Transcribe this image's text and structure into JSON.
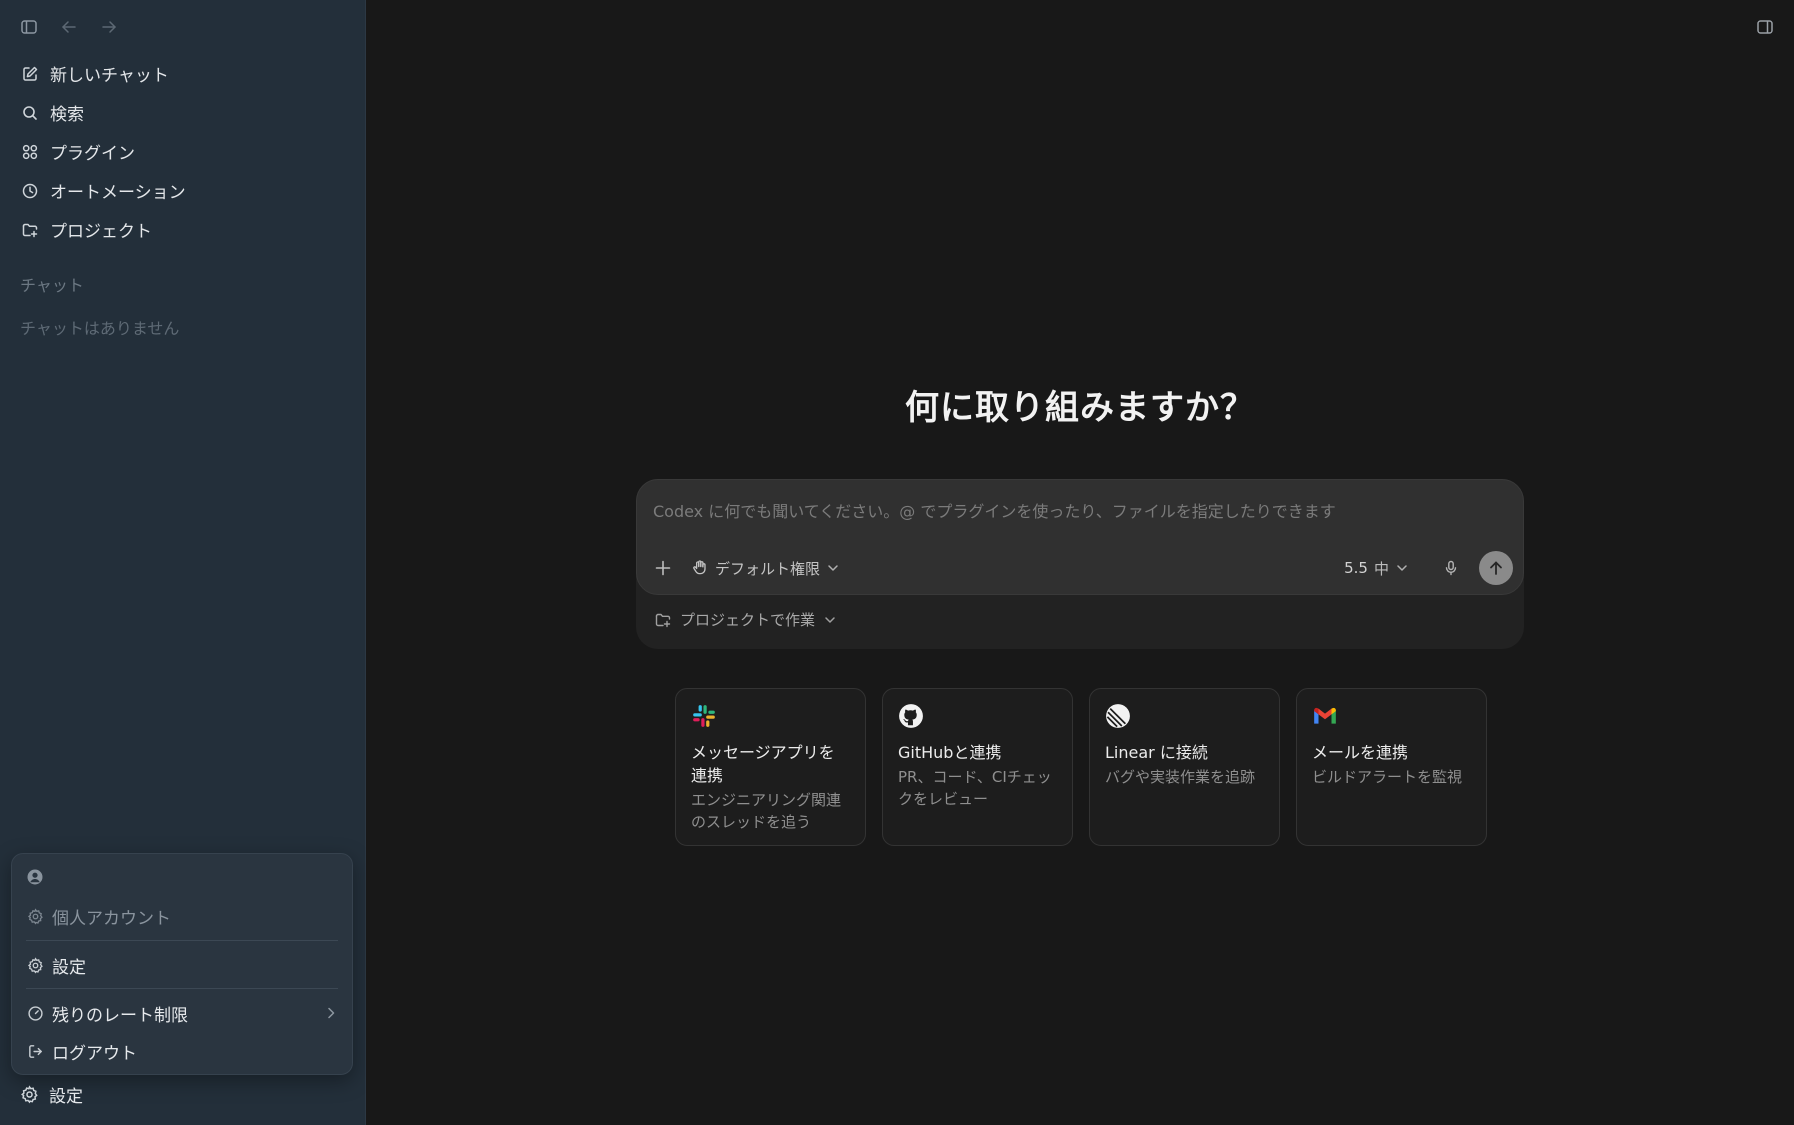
{
  "sidebar": {
    "nav": [
      {
        "label": "新しいチャット",
        "icon": "compose-icon"
      },
      {
        "label": "検索",
        "icon": "search-icon"
      },
      {
        "label": "プラグイン",
        "icon": "plugins-grid-icon"
      },
      {
        "label": "オートメーション",
        "icon": "clock-icon"
      },
      {
        "label": "プロジェクト",
        "icon": "folder-add-icon"
      }
    ],
    "chats_section_label": "チャット",
    "chats_empty_label": "チャットはありません",
    "account_menu": {
      "personal_account": "個人アカウント",
      "settings": "設定",
      "rate_limit": "残りのレート制限",
      "logout": "ログアウト"
    },
    "bottom_settings_label": "設定"
  },
  "main": {
    "headline": "何に取り組みますか？",
    "composer": {
      "placeholder": "Codex に何でも聞いてください。@ でプラグインを使ったり、ファイルを指定したりできます",
      "permission_label": "デフォルト権限",
      "model_version": "5.5",
      "model_effort": "中",
      "project_label": "プロジェクトで作業"
    },
    "cards": [
      {
        "title": "メッセージアプリを連携",
        "desc": "エンジニアリング関連のスレッドを追う",
        "icon": "slack-icon"
      },
      {
        "title": "GitHubと連携",
        "desc": "PR、コード、CIチェックをレビュー",
        "icon": "github-icon"
      },
      {
        "title": "Linear に接続",
        "desc": "バグや実装作業を追跡",
        "icon": "linear-icon"
      },
      {
        "title": "メールを連携",
        "desc": "ビルドアラートを監視",
        "icon": "gmail-icon"
      }
    ]
  },
  "colors": {
    "sidebar_bg": "#232f3a",
    "main_bg": "#181818",
    "composer_bg": "#303030",
    "send_button": "#8a8a8a"
  }
}
